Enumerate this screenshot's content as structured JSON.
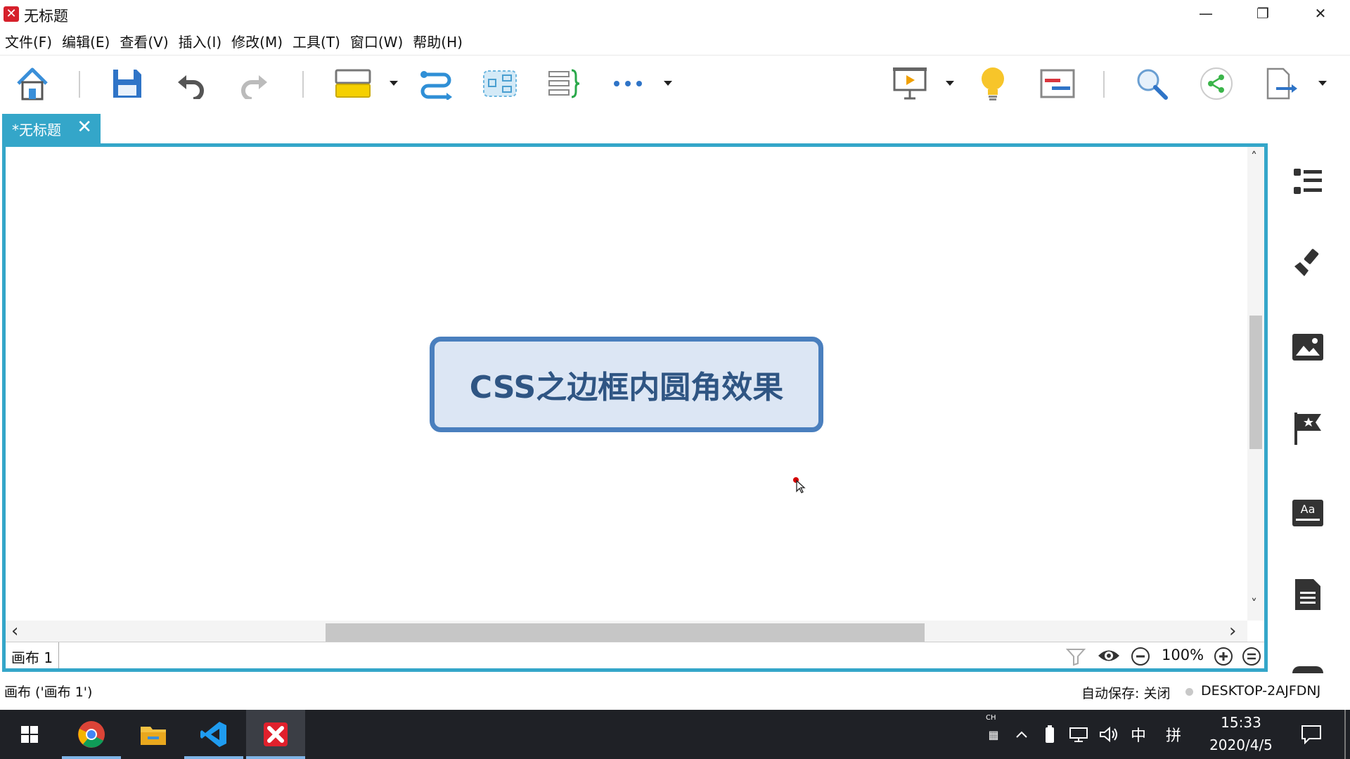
{
  "window": {
    "title": "无标题",
    "app_icon_glyph": "✕",
    "controls": {
      "minimize": "—",
      "restore": "❐",
      "close": "✕"
    }
  },
  "menu": [
    "文件(F)",
    "编辑(E)",
    "查看(V)",
    "插入(I)",
    "修改(M)",
    "工具(T)",
    "窗口(W)",
    "帮助(H)"
  ],
  "toolbar": {
    "icons": [
      "home-icon",
      "save-icon",
      "undo-icon",
      "redo-icon",
      "topic-icon",
      "relationship-icon",
      "boundary-icon",
      "summary-icon",
      "more-icon",
      "presentation-icon",
      "lightbulb-icon",
      "gantt-icon",
      "search-icon",
      "share-icon",
      "export-icon"
    ]
  },
  "tab": {
    "label": "*无标题",
    "close": "✕"
  },
  "canvas": {
    "central_topic": "CSS之边框内圆角效果",
    "sheet_name": "画布 1",
    "zoom": "100%"
  },
  "scroll": {
    "left": "‹",
    "right": "›",
    "up": "˄",
    "down": "˅"
  },
  "right_panel": [
    "outline-icon",
    "format-icon",
    "image-icon",
    "marker-icon",
    "text-style-icon",
    "notes-icon"
  ],
  "status": {
    "left": "画布 ('画布 1')",
    "autosave": "自动保存: 关闭",
    "computer": "DESKTOP-2AJFDNJ"
  },
  "taskbar": {
    "apps": [
      "windows-start-icon",
      "chrome-icon",
      "file-explorer-icon",
      "vscode-icon",
      "xmind-icon"
    ],
    "tray": {
      "lang_small": "CH",
      "ime": "中",
      "ime2": "拼",
      "time": "15:33",
      "date": "2020/4/5"
    }
  },
  "colors": {
    "accent": "#34a6c9",
    "topic_border": "#4a7fbe",
    "topic_fill": "#dce6f4",
    "topic_text": "#2f5583"
  }
}
